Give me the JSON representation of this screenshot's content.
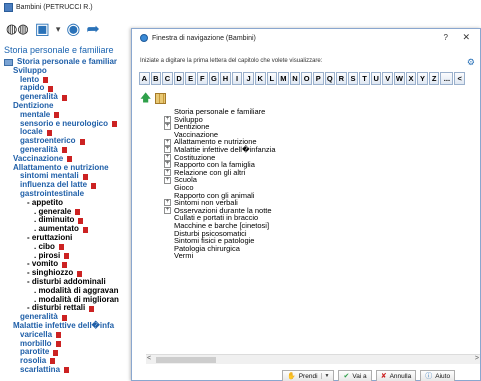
{
  "main": {
    "title": "Bambini (PETRUCCI R.)",
    "toolbar": {
      "icons": [
        "binoculars-icon",
        "document-icon",
        "globe-icon",
        "share-icon"
      ]
    },
    "left_header": "Storia personale e familiare",
    "tree": [
      {
        "label": "Storia personale e familiar",
        "flag": false,
        "indent": 0,
        "root": true
      },
      {
        "label": "Sviluppo",
        "flag": false,
        "indent": 1
      },
      {
        "label": "lento",
        "flag": true,
        "indent": 2
      },
      {
        "label": "rapido",
        "flag": true,
        "indent": 2
      },
      {
        "label": "generalità",
        "flag": true,
        "indent": 2
      },
      {
        "label": "Dentizione",
        "flag": false,
        "indent": 1
      },
      {
        "label": "mentale",
        "flag": true,
        "indent": 2
      },
      {
        "label": "sensorio e neurologico",
        "flag": true,
        "indent": 2
      },
      {
        "label": "locale",
        "flag": true,
        "indent": 2
      },
      {
        "label": "gastroenterico",
        "flag": true,
        "indent": 2
      },
      {
        "label": "generalità",
        "flag": true,
        "indent": 2
      },
      {
        "label": "Vaccinazione",
        "flag": true,
        "indent": 1
      },
      {
        "label": "Allattamento e nutrizione",
        "flag": false,
        "indent": 1
      },
      {
        "label": "sintomi mentali",
        "flag": true,
        "indent": 2
      },
      {
        "label": "influenza del latte",
        "flag": true,
        "indent": 2
      },
      {
        "label": "gastrointestinale",
        "flag": false,
        "indent": 2
      },
      {
        "label": "- appetito",
        "flag": false,
        "indent": 3,
        "black": true
      },
      {
        "label": ". generale",
        "flag": true,
        "indent": 4,
        "black": true
      },
      {
        "label": ". diminuito",
        "flag": true,
        "indent": 4,
        "black": true
      },
      {
        "label": ". aumentato",
        "flag": true,
        "indent": 4,
        "black": true
      },
      {
        "label": "- eruttazioni",
        "flag": false,
        "indent": 3,
        "black": true
      },
      {
        "label": ". cibo",
        "flag": true,
        "indent": 4,
        "black": true
      },
      {
        "label": ". pirosi",
        "flag": true,
        "indent": 4,
        "black": true
      },
      {
        "label": "- vomito",
        "flag": true,
        "indent": 3,
        "black": true
      },
      {
        "label": "- singhiozzo",
        "flag": true,
        "indent": 3,
        "black": true
      },
      {
        "label": "- disturbi addominali",
        "flag": false,
        "indent": 3,
        "black": true
      },
      {
        "label": ". modalità di aggravan",
        "flag": false,
        "indent": 4,
        "black": true
      },
      {
        "label": ". modalità di miglioran",
        "flag": false,
        "indent": 4,
        "black": true
      },
      {
        "label": "- disturbi rettali",
        "flag": true,
        "indent": 3,
        "black": true
      },
      {
        "label": "generalità",
        "flag": true,
        "indent": 2
      },
      {
        "label": "Malattie infettive dell�infa",
        "flag": false,
        "indent": 1
      },
      {
        "label": "varicella",
        "flag": true,
        "indent": 2
      },
      {
        "label": "morbillo",
        "flag": true,
        "indent": 2
      },
      {
        "label": "parotite",
        "flag": true,
        "indent": 2
      },
      {
        "label": "rosolia",
        "flag": true,
        "indent": 2
      },
      {
        "label": "scarlattina",
        "flag": true,
        "indent": 2
      }
    ]
  },
  "dialog": {
    "title": "Finestra di navigazione (Bambini)",
    "help": "?",
    "close": "✕",
    "instruction": "Iniziate a digitare la prima lettera del capitolo che volete visualizzare:",
    "letters": [
      "A",
      "B",
      "C",
      "D",
      "E",
      "F",
      "G",
      "H",
      "I",
      "J",
      "K",
      "L",
      "M",
      "N",
      "O",
      "P",
      "Q",
      "R",
      "S",
      "T",
      "U",
      "V",
      "W",
      "X",
      "Y",
      "Z",
      "...",
      "<"
    ],
    "items": [
      {
        "label": "Storia personale e familiare",
        "expandable": false
      },
      {
        "label": "Sviluppo",
        "expandable": true
      },
      {
        "label": "Dentizione",
        "expandable": true
      },
      {
        "label": "Vaccinazione",
        "expandable": false
      },
      {
        "label": "Allattamento e nutrizione",
        "expandable": true
      },
      {
        "label": "Malattie infettive dell�infanzia",
        "expandable": true
      },
      {
        "label": "Costituzione",
        "expandable": true
      },
      {
        "label": "Rapporto con la famiglia",
        "expandable": true
      },
      {
        "label": "Relazione con gli altri",
        "expandable": true
      },
      {
        "label": "Scuola",
        "expandable": true
      },
      {
        "label": "Gioco",
        "expandable": false
      },
      {
        "label": "Rapporto con gli animali",
        "expandable": false
      },
      {
        "label": "Sintomi non verbali",
        "expandable": true
      },
      {
        "label": "Osservazioni durante la notte",
        "expandable": true
      },
      {
        "label": "Cullati e portati in braccio",
        "expandable": false
      },
      {
        "label": "Macchine e barche [cinetosi]",
        "expandable": false
      },
      {
        "label": "Disturbi psicosomatici",
        "expandable": false
      },
      {
        "label": "Sintomi fisici e patologie",
        "expandable": false
      },
      {
        "label": "Patologia chirurgica",
        "expandable": false
      },
      {
        "label": "Vermi",
        "expandable": false
      }
    ],
    "buttons": {
      "prendi": "Prendi",
      "vaia": "Vai a",
      "annulla": "Annulla",
      "aiuto": "Aiuto"
    },
    "scroll": {
      "left_arrow": "<",
      "right_arrow": ">"
    }
  },
  "colors": {
    "tree_blue": "#1f5fa8",
    "flag_red": "#cc2222",
    "accent": "#2a72b8"
  }
}
